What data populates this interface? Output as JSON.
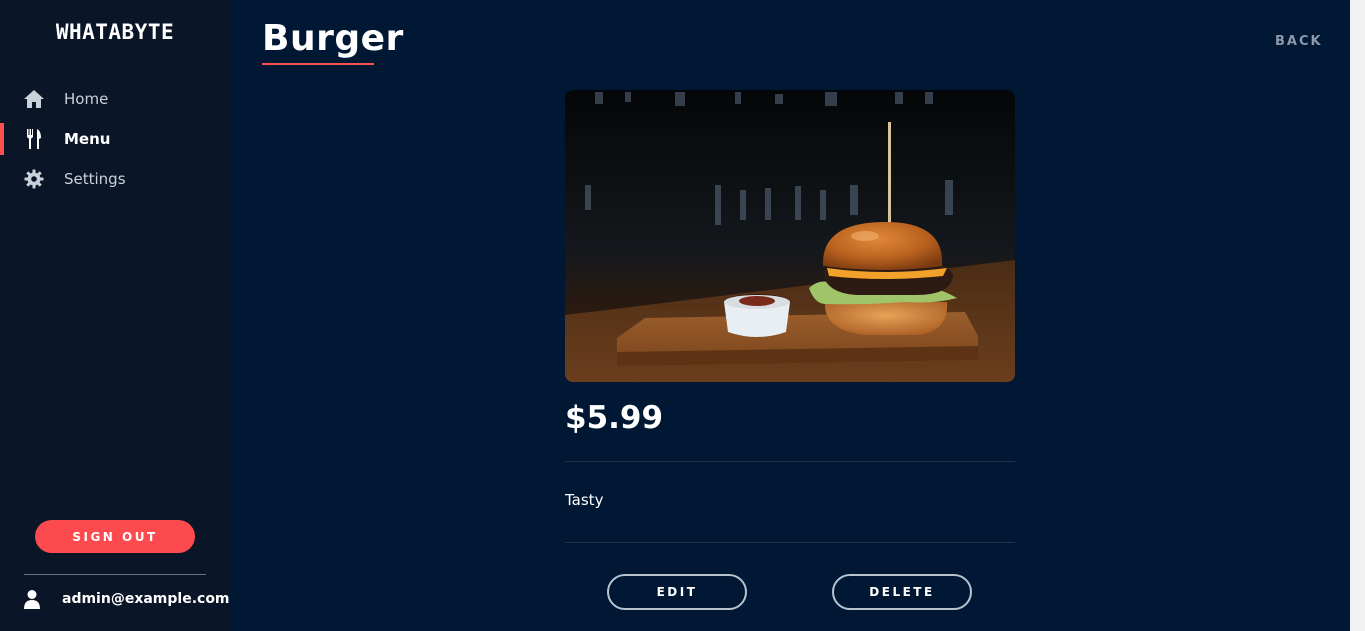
{
  "brand": "WHATABYTE",
  "nav": {
    "home": "Home",
    "menu": "Menu",
    "settings": "Settings"
  },
  "sidebar": {
    "signout_label": "SIGN OUT",
    "user_email": "admin@example.com"
  },
  "page": {
    "title": "Burger",
    "back_label": "BACK"
  },
  "item": {
    "price": "$5.99",
    "description": "Tasty",
    "edit_label": "EDIT",
    "delete_label": "DELETE"
  },
  "icons": {
    "home": "home-icon",
    "menu": "utensils-icon",
    "settings": "gear-icon",
    "user": "user-icon"
  },
  "colors": {
    "accent": "#fd4a4f",
    "background": "#001833",
    "sidebar": "#0a1627"
  }
}
